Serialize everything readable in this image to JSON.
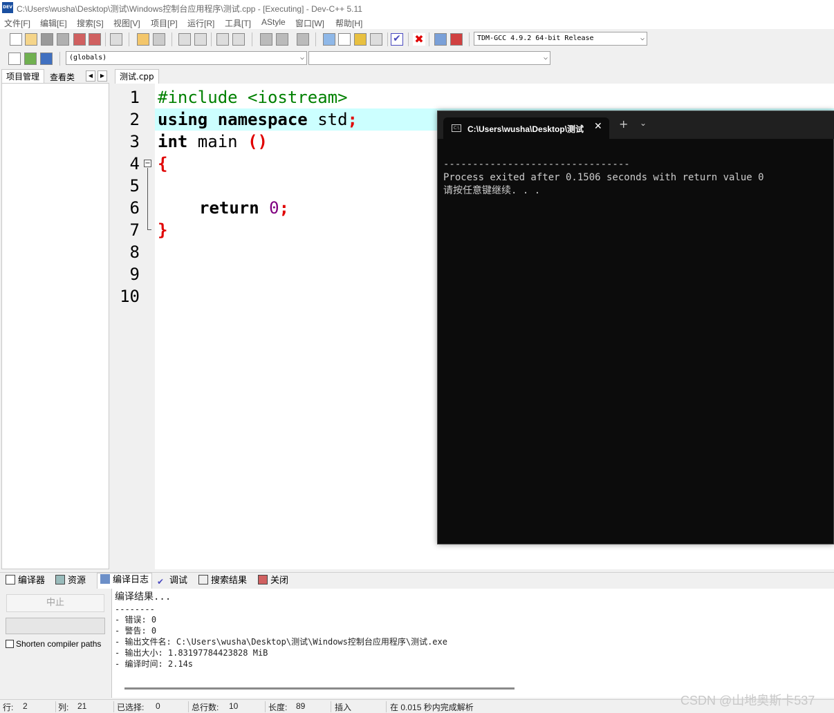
{
  "window": {
    "title": "C:\\Users\\wusha\\Desktop\\测试\\Windows控制台应用程序\\测试.cpp - [Executing] - Dev-C++ 5.11",
    "app_icon_text": "DEV"
  },
  "menu": [
    "文件[F]",
    "编辑[E]",
    "搜索[S]",
    "视图[V]",
    "项目[P]",
    "运行[R]",
    "工具[T]",
    "AStyle",
    "窗口[W]",
    "帮助[H]"
  ],
  "toolbar": {
    "compiler_select": "TDM-GCC 4.9.2 64-bit Release",
    "scope_select": "(globals)",
    "function_select": ""
  },
  "left_panel": {
    "tabs": [
      "项目管理",
      "查看类"
    ]
  },
  "editor": {
    "tab": "测试.cpp",
    "line_numbers": [
      "1",
      "2",
      "3",
      "4",
      "5",
      "6",
      "7",
      "8",
      "9",
      "10"
    ],
    "code": {
      "l1": "#include <iostream>",
      "l2_kw": "using namespace",
      "l2_rest": " std",
      "l2_semi": ";",
      "l3_kw": "int",
      "l3_rest": " main ",
      "l3_paren": "()",
      "l4": "{",
      "l6_kw": "return",
      "l6_num": "0",
      "l6_semi": ";",
      "l7": "}"
    }
  },
  "console": {
    "tab_title": "C:\\Users\\wusha\\Desktop\\测试",
    "lines": [
      "--------------------------------",
      "Process exited after 0.1506 seconds with return value 0",
      "请按任意键继续. . ."
    ]
  },
  "bottom_tabs": [
    "编译器",
    "资源",
    "编译日志",
    "调试",
    "搜索结果",
    "关闭"
  ],
  "compile": {
    "stop_button": "中止",
    "shorten_paths_label": "Shorten compiler paths",
    "shorten_paths_checked": false,
    "log": [
      "编译结果...",
      "--------",
      "- 错误: 0",
      "- 警告: 0",
      "- 输出文件名: C:\\Users\\wusha\\Desktop\\测试\\Windows控制台应用程序\\测试.exe",
      "- 输出大小: 1.83197784423828 MiB",
      "- 编译时间: 2.14s"
    ]
  },
  "status": {
    "row_label": "行:",
    "row": "2",
    "col_label": "列:",
    "col": "21",
    "sel_label": "已选择:",
    "sel": "0",
    "total_label": "总行数:",
    "total": "10",
    "len_label": "长度:",
    "len": "89",
    "mode": "插入",
    "parse": "在 0.015 秒内完成解析"
  },
  "watermark": "CSDN @山地奥斯卡537",
  "colors": {
    "current_line": "#ccffff",
    "preprocessor": "#008000",
    "symbol": "#e00000",
    "number": "#800080",
    "console_bg": "#0c0c0c"
  }
}
